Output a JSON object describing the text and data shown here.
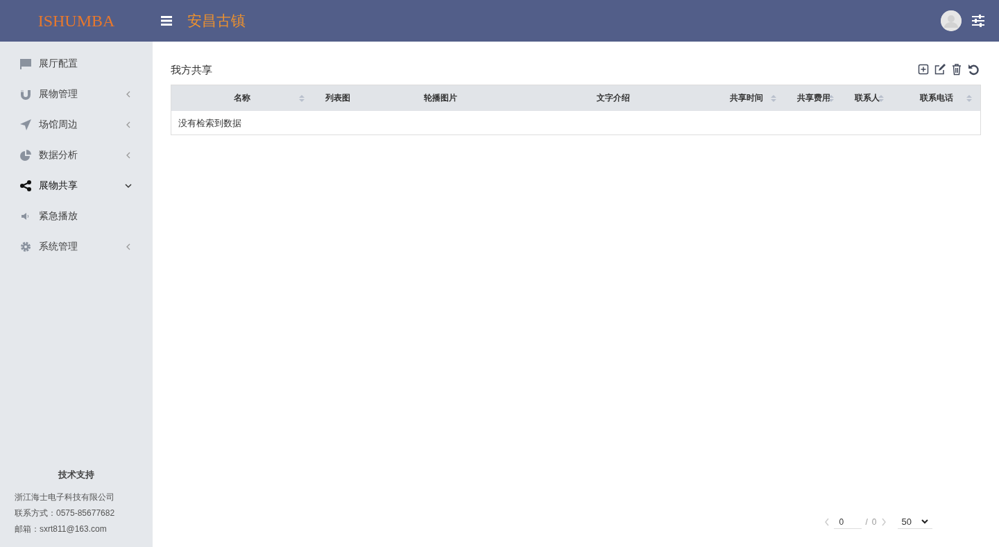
{
  "header": {
    "logo": "ISHUMBA",
    "title": "安昌古镇"
  },
  "sidebar": {
    "items": [
      {
        "label": "展厅配置",
        "kind": "flag",
        "expandable": false,
        "selected": false
      },
      {
        "label": "展物管理",
        "kind": "magnet",
        "expandable": true,
        "expanded": false,
        "selected": false
      },
      {
        "label": "场馆周边",
        "kind": "arrow",
        "expandable": true,
        "expanded": false,
        "selected": false
      },
      {
        "label": "数据分析",
        "kind": "pie",
        "expandable": true,
        "expanded": false,
        "selected": false
      },
      {
        "label": "展物共享",
        "kind": "share",
        "expandable": true,
        "expanded": true,
        "selected": true
      },
      {
        "label": "紧急播放",
        "kind": "volume",
        "expandable": false,
        "selected": false
      },
      {
        "label": "系统管理",
        "kind": "gear",
        "expandable": true,
        "expanded": false,
        "selected": false
      }
    ],
    "footer": {
      "title": "技术支持",
      "lines": [
        "浙江海士电子科技有限公司",
        "联系方式：0575-85677682",
        "邮箱：sxrt811@163.com"
      ]
    }
  },
  "main": {
    "title": "我方共享",
    "table": {
      "columns": [
        {
          "label": "名称",
          "sortable": true
        },
        {
          "label": "列表图",
          "sortable": false
        },
        {
          "label": "轮播图片",
          "sortable": false
        },
        {
          "label": "文字介绍",
          "sortable": false
        },
        {
          "label": "共享时间",
          "sortable": true
        },
        {
          "label": "共享费用",
          "sortable": true
        },
        {
          "label": "联系人",
          "sortable": true
        },
        {
          "label": "联系电话",
          "sortable": true
        }
      ],
      "empty_message": "没有检索到数据"
    },
    "pagination": {
      "page": "0",
      "separator": "/",
      "total": "0",
      "page_size": "50"
    }
  }
}
